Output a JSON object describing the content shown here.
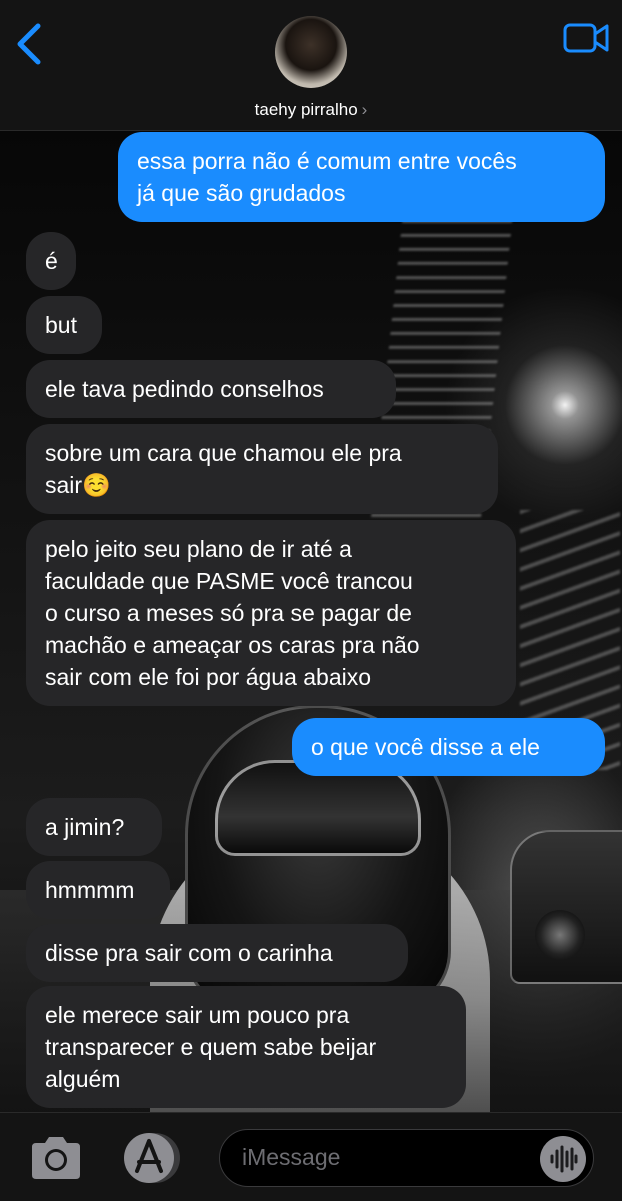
{
  "header": {
    "contact_name": "taehy pirralho",
    "chevron": "›",
    "back_icon": "chevron-left-icon",
    "video_icon": "video-camera-icon",
    "accent": "#1a8cfe"
  },
  "messages": [
    {
      "from": "me",
      "text": "essa porra não é comum entre vocês\njá que são grudados"
    },
    {
      "from": "them",
      "text": "é"
    },
    {
      "from": "them",
      "text": "but"
    },
    {
      "from": "them",
      "text": "ele tava pedindo conselhos"
    },
    {
      "from": "them",
      "text": "sobre um cara que chamou ele pra\nsair☺️"
    },
    {
      "from": "them",
      "text": "pelo jeito seu plano de ir até a\nfaculdade que PASME você trancou\no curso a meses só pra se pagar de\nmachão e ameaçar os caras pra não\nsair com ele foi por água abaixo"
    },
    {
      "from": "me",
      "text": "o que você disse a ele"
    },
    {
      "from": "them",
      "text": "a jimin?"
    },
    {
      "from": "them",
      "text": "hmmmm"
    },
    {
      "from": "them",
      "text": "disse pra sair com o carinha"
    },
    {
      "from": "them",
      "text": "ele merece sair um pouco pra\ntransparecer e quem sabe beijar\nalguém"
    }
  ],
  "composer": {
    "placeholder": "iMessage",
    "camera_icon": "camera-icon",
    "apps_icon": "app-store-icon",
    "audio_icon": "waveform-icon"
  },
  "colors": {
    "sent_bubble": "#1a8cfe",
    "received_bubble": "#262628",
    "bar_background": "#141414"
  }
}
